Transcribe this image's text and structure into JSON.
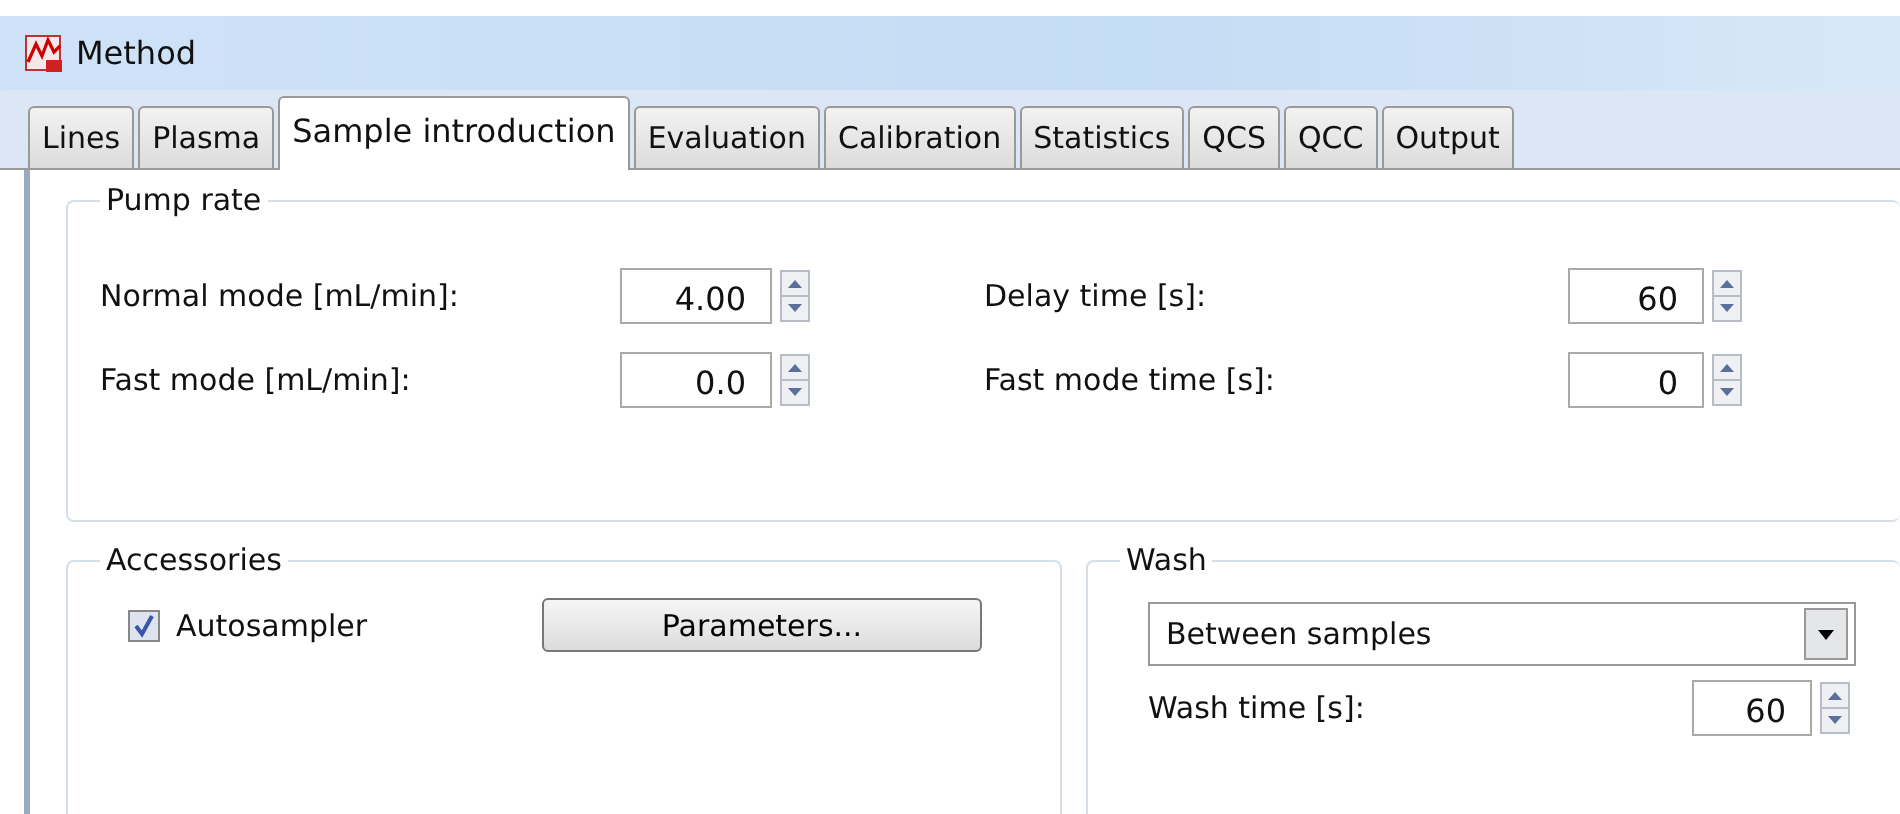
{
  "window": {
    "title": "Method"
  },
  "tabs": [
    {
      "label": "Lines",
      "selected": false
    },
    {
      "label": "Plasma",
      "selected": false
    },
    {
      "label": "Sample introduction",
      "selected": true
    },
    {
      "label": "Evaluation",
      "selected": false
    },
    {
      "label": "Calibration",
      "selected": false
    },
    {
      "label": "Statistics",
      "selected": false
    },
    {
      "label": "QCS",
      "selected": false
    },
    {
      "label": "QCC",
      "selected": false
    },
    {
      "label": "Output",
      "selected": false
    }
  ],
  "pump_rate": {
    "title": "Pump rate",
    "left": [
      {
        "label": "Normal mode [mL/min]:",
        "value": "4.00"
      },
      {
        "label": "Fast mode [mL/min]:",
        "value": "0.0"
      }
    ],
    "right": [
      {
        "label": "Delay time [s]:",
        "value": "60"
      },
      {
        "label": "Fast mode time [s]:",
        "value": "0"
      }
    ]
  },
  "accessories": {
    "title": "Accessories",
    "autosampler": {
      "label": "Autosampler",
      "checked": true
    },
    "button": "Parameters..."
  },
  "wash": {
    "title": "Wash",
    "mode": "Between samples",
    "time": {
      "label": "Wash time [s]:",
      "value": "60"
    }
  }
}
